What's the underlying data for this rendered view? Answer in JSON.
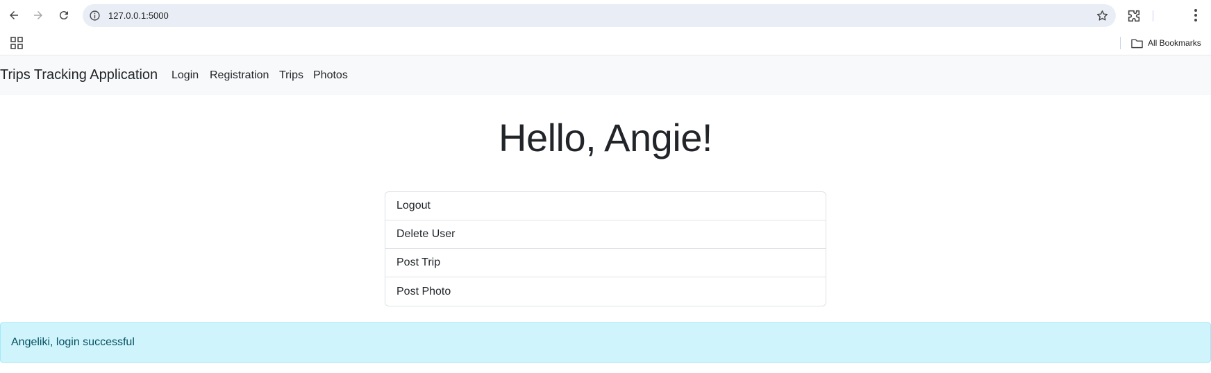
{
  "browser": {
    "url": "127.0.0.1:5000",
    "bookmarks_label": "All Bookmarks"
  },
  "navbar": {
    "brand": "Trips Tracking Application",
    "links": [
      "Login",
      "Registration",
      "Trips",
      "Photos"
    ]
  },
  "main": {
    "greeting": "Hello, Angie!",
    "actions": [
      "Logout",
      "Delete User",
      "Post Trip",
      "Post Photo"
    ]
  },
  "alert": {
    "message": "Angeliki, login successful"
  },
  "colors": {
    "navbar_bg": "#f8f9fa",
    "alert_bg": "#cff4fc",
    "alert_text": "#055160",
    "omnibox_bg": "#e9eef6"
  }
}
